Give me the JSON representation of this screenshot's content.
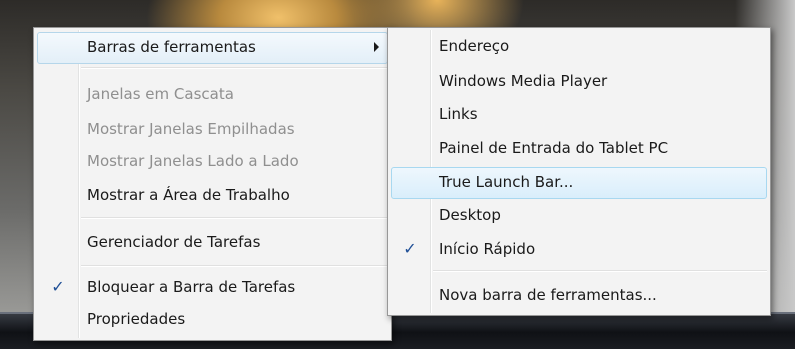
{
  "context_menu": {
    "items": [
      {
        "label": "Barras de ferramentas"
      },
      {
        "label": "Janelas em Cascata"
      },
      {
        "label": "Mostrar Janelas Empilhadas"
      },
      {
        "label": "Mostrar Janelas Lado a Lado"
      },
      {
        "label": "Mostrar a Área de Trabalho"
      },
      {
        "label": "Gerenciador de Tarefas"
      },
      {
        "label": "Bloquear a Barra de Tarefas",
        "checked": true
      },
      {
        "label": "Propriedades"
      }
    ],
    "check_glyph": "✓"
  },
  "toolbars_submenu": {
    "items": [
      {
        "label": "Endereço"
      },
      {
        "label": "Windows Media Player"
      },
      {
        "label": "Links"
      },
      {
        "label": "Painel de Entrada do Tablet PC"
      },
      {
        "label": "True Launch Bar..."
      },
      {
        "label": "Desktop"
      },
      {
        "label": "Início Rápido",
        "checked": true
      },
      {
        "label": "Nova barra de ferramentas..."
      }
    ],
    "check_glyph": "✓"
  },
  "colors": {
    "menu_background": "#f3f3f3",
    "hover_border": "#a8d8f0",
    "disabled_text": "#8f8f8f",
    "check": "#1f4f96"
  }
}
